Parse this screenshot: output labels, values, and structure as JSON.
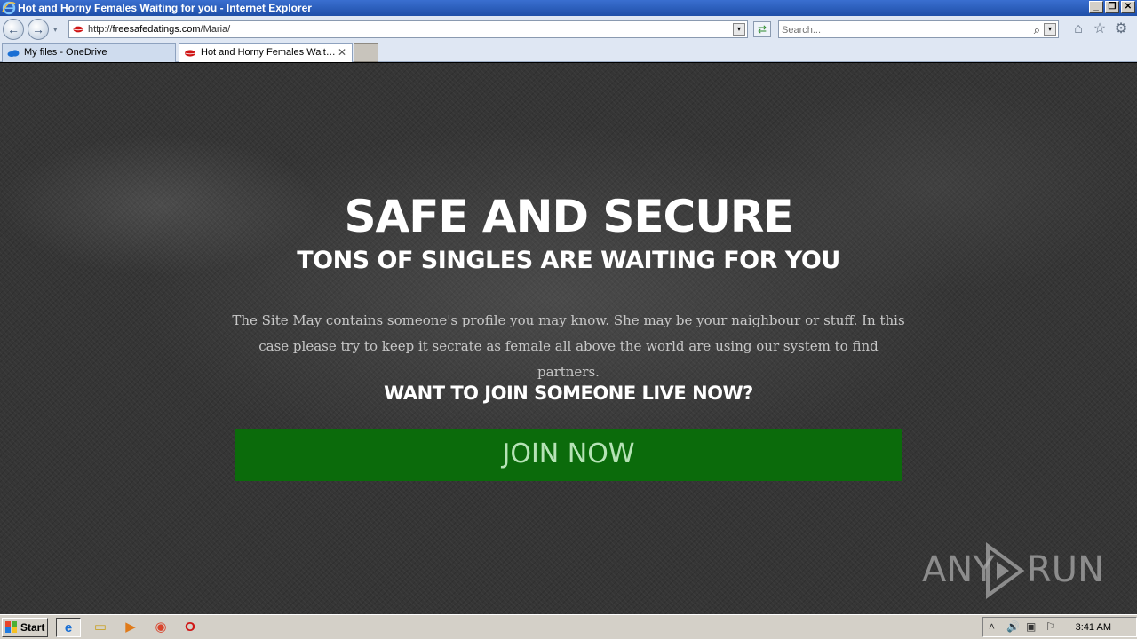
{
  "window": {
    "title": "Hot and Horny Females Waiting for you - Internet Explorer",
    "controls": [
      "_",
      "❐",
      "✕"
    ]
  },
  "navbar": {
    "back_glyph": "←",
    "forward_glyph": "→",
    "dropdown_glyph": "▾",
    "address": {
      "scheme": "http://",
      "host": "freesafedatings.com",
      "path": "/Maria/"
    },
    "search_placeholder": "Search...",
    "search_glyph": "⌕",
    "refresh_glyph": "⇄",
    "home_glyph": "⌂",
    "favorites_glyph": "☆",
    "tools_glyph": "⚙"
  },
  "tabs": [
    {
      "label": "My files - OneDrive",
      "active": false
    },
    {
      "label": "Hot and Horny Females Wait…",
      "active": true,
      "close": "✕"
    }
  ],
  "page": {
    "title": "SAFE AND SECURE",
    "subtitle": "TONS OF SINGLES ARE WAITING FOR YOU",
    "body_line1": "The Site May contains someone's profile you may know. She may be your naighbour or stuff. In this",
    "body_line2": "case please try to keep it secrate as female all above the world are using our system to find partners.",
    "question": "WANT TO JOIN SOMEONE LIVE NOW?",
    "join_label": "JOIN NOW",
    "join_color": "#0b6b0b"
  },
  "watermark": {
    "left": "ANY",
    "right": "RUN"
  },
  "taskbar": {
    "start_label": "Start",
    "tasks": [
      {
        "name": "internet-explorer",
        "glyph": "e"
      },
      {
        "name": "file-explorer",
        "glyph": "▭"
      },
      {
        "name": "media-player",
        "glyph": "▶"
      },
      {
        "name": "chrome",
        "glyph": "◉"
      },
      {
        "name": "opera",
        "glyph": "O"
      }
    ],
    "tray_up": "˄",
    "clock": "3:41 AM"
  }
}
